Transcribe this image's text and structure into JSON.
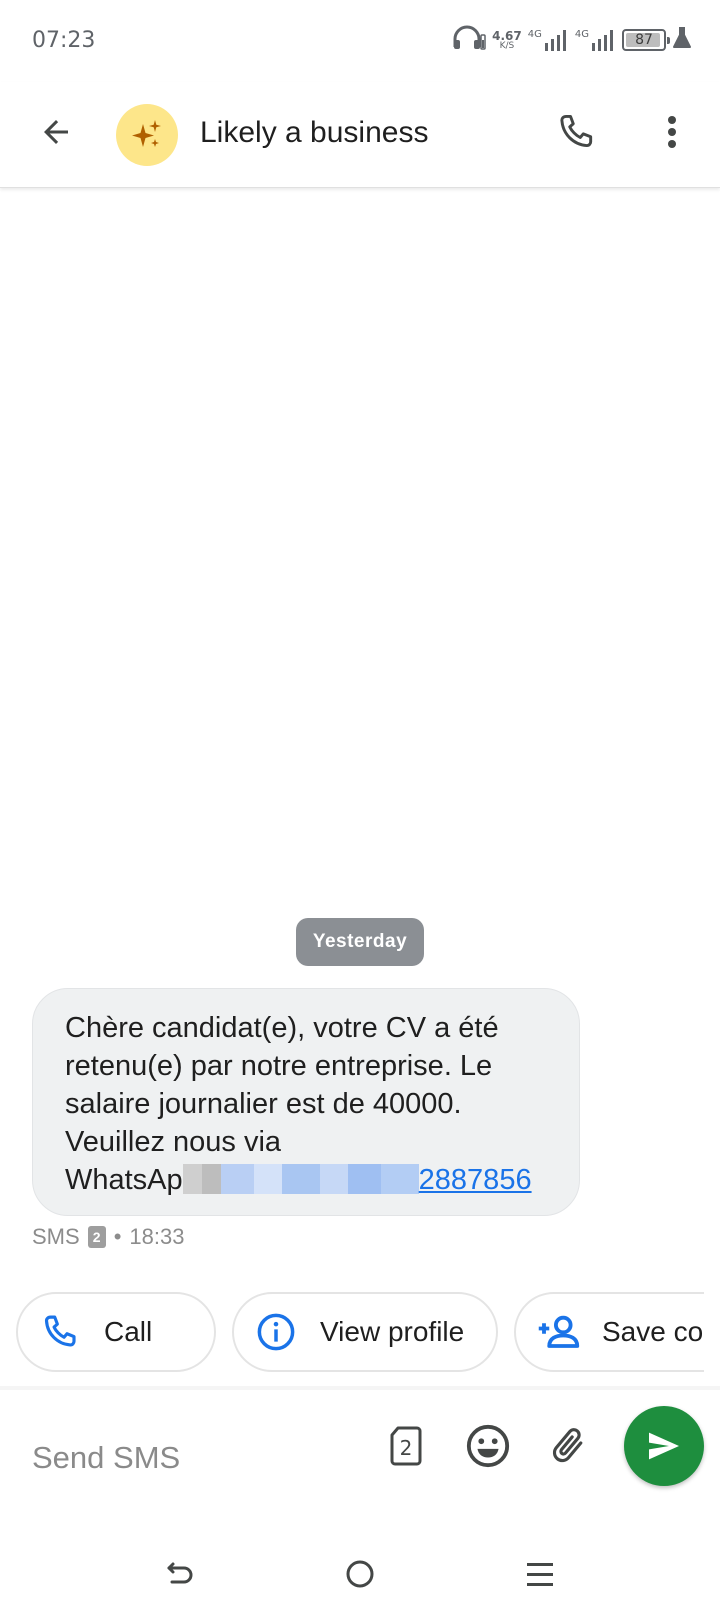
{
  "status_bar": {
    "time": "07:23",
    "net_speed_value": "4.67",
    "net_speed_unit": "K/S",
    "sim1_label": "4G",
    "sim2_label": "4G",
    "battery_percent": 87
  },
  "header": {
    "title": "Likely a business"
  },
  "conversation": {
    "date_chip": "Yesterday",
    "message": {
      "lines": [
        "Chère candidat(e), votre CV a été",
        "retenu(e) par notre entreprise. Le",
        "salaire journalier est de 40000.",
        "Veuillez nous via"
      ],
      "last_line_prefix": "WhatsAp",
      "link_suffix": "2887856"
    },
    "meta": {
      "type": "SMS",
      "sim": "2",
      "separator": "•",
      "time": "18:33"
    }
  },
  "suggestions": {
    "call_label": "Call",
    "view_profile_label": "View profile",
    "save_contact_label": "Save con"
  },
  "compose": {
    "placeholder": "Send SMS",
    "sim_number": "2"
  },
  "colors": {
    "accent_blue": "#1a73e8",
    "send_green": "#1e8e3e",
    "avatar_yellow": "#fde68a",
    "chip_gray": "#8b8f94"
  }
}
